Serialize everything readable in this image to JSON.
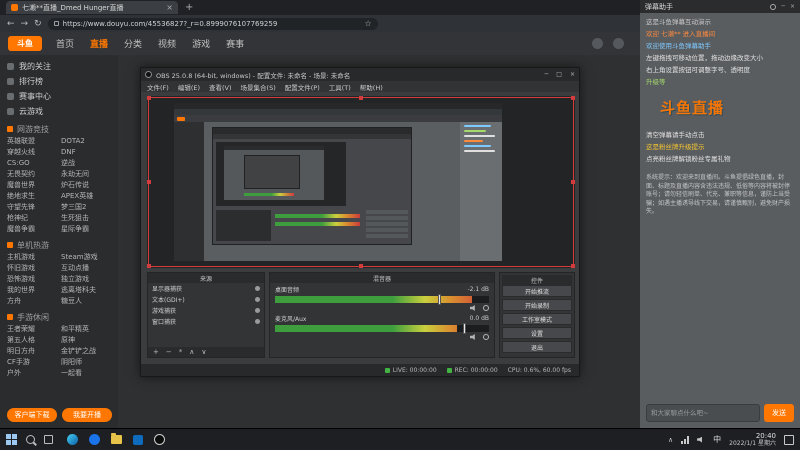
{
  "browser": {
    "tab_title": "七濑**直播_Dmed Hunger直播",
    "tab_close": "×",
    "new_tab": "+",
    "back": "←",
    "forward": "→",
    "reload": "↻",
    "url": "https://www.douyu.com/45536827?_r=0.8999076107769259",
    "bookmark_star": "☆",
    "win_min": "─",
    "win_max": "□",
    "win_close": "×"
  },
  "header": {
    "logo": "斗鱼",
    "nav": [
      "首页",
      "直播",
      "分类",
      "视频",
      "游戏",
      "赛事"
    ]
  },
  "sidebar": {
    "top_items": [
      "我的关注",
      "排行榜",
      "赛事中心",
      "云游戏"
    ],
    "sections": [
      {
        "title": "网游竞技",
        "games": [
          "英雄联盟",
          "DOTA2",
          "穿越火线",
          "DNF",
          "CS:GO",
          "逆战",
          "无畏契约",
          "永劫无间",
          "魔兽世界",
          "炉石传说",
          "绝地求生",
          "APEX英雄",
          "守望先锋",
          "梦三国2",
          "枪神纪",
          "生死狙击",
          "魔兽争霸",
          "星际争霸"
        ]
      },
      {
        "title": "单机热游",
        "games": [
          "主机游戏",
          "Steam游戏",
          "怀旧游戏",
          "互动点播",
          "恐怖游戏",
          "独立游戏",
          "我的世界",
          "逃离塔科夫",
          "方舟",
          "糖豆人"
        ]
      },
      {
        "title": "手游休闲",
        "games": [
          "王者荣耀",
          "和平精英",
          "第五人格",
          "原神",
          "明日方舟",
          "金铲铲之战",
          "CF手游",
          "阴阳师",
          "户外",
          "一起看"
        ]
      }
    ],
    "download_btn": "客户端下载",
    "broadcast_btn": "我要开播"
  },
  "obs": {
    "window_title": "OBS 25.0.8 (64-bit, windows) - 配置文件: 未命名 - 场景: 未命名",
    "win_min": "─",
    "win_max": "□",
    "win_close": "×",
    "menus": [
      "文件(F)",
      "编辑(E)",
      "查看(V)",
      "场景集合(S)",
      "配置文件(P)",
      "工具(T)",
      "帮助(H)"
    ],
    "sources_title": "来源",
    "sources": [
      "显示器捕获",
      "文本(GDI+)",
      "游戏捕获",
      "窗口捕获"
    ],
    "sources_toolbar": [
      "+",
      "−",
      "*",
      "∧",
      "∨"
    ],
    "mixer_title": "混音器",
    "channels": [
      {
        "name": "桌面音频",
        "db": "-2.1 dB"
      },
      {
        "name": "麦克风/Aux",
        "db": "0.0 dB"
      }
    ],
    "controls_title": "控件",
    "control_buttons": [
      "开始推流",
      "开始录制",
      "工作室模式",
      "设置",
      "退出"
    ],
    "status_live": "LIVE: 00:00:00",
    "status_rec": "REC: 00:00:00",
    "status_cpu": "CPU: 0.6%, 60.00 fps"
  },
  "chat": {
    "helper_title": "弹幕助手",
    "helper_min": "─",
    "helper_close": "×",
    "watermark": "斗鱼直播",
    "messages": [
      {
        "text": "这是斗鱼弹幕互动演示",
        "color": "#c8c8c8"
      },
      {
        "text": "欢迎 七濑** 进入直播间",
        "color": "#ff8a3c"
      },
      {
        "text": "欢迎使用斗鱼弹幕助手",
        "color": "#7ec9ff"
      },
      {
        "text": "左键拖拽可移动位置，拖动边缘改变大小",
        "color": "#e2e2e2"
      },
      {
        "text": "右上角设置按钮可调整字号、透明度",
        "color": "#e2e2e2"
      },
      {
        "text": "升级等",
        "color": "#a4d96c"
      },
      {
        "text": "清空弹幕请手动点击",
        "color": "#e2e2e2"
      },
      {
        "text": "这是粉丝牌升级提示",
        "color": "#f4c430"
      },
      {
        "text": "点亮粉丝牌解锁粉丝专属礼物",
        "color": "#e2e2e2"
      }
    ],
    "notice": "系统提示：欢迎来到直播间。斗鱼提倡绿色直播，封面、标题及直播内容含违法违规、低俗等内容将被封停账号；请勿轻信刷单、代充、兼职等信息，谨防上当受骗；如遇主播诱导线下交易，请谨慎甄别，避免财产损失。",
    "input_placeholder": "和大家聊点什么吧~",
    "send_btn": "发送"
  },
  "taskbar": {
    "ime": "中",
    "time": "20:40",
    "date": "2022/1/1 星期六"
  },
  "colors": {
    "accent_orange": "#ff7700",
    "meter_green": "#3e9e3e",
    "meter_red": "#cc3b3b",
    "selection_red": "#d23c3c",
    "status_green": "#43b343"
  }
}
